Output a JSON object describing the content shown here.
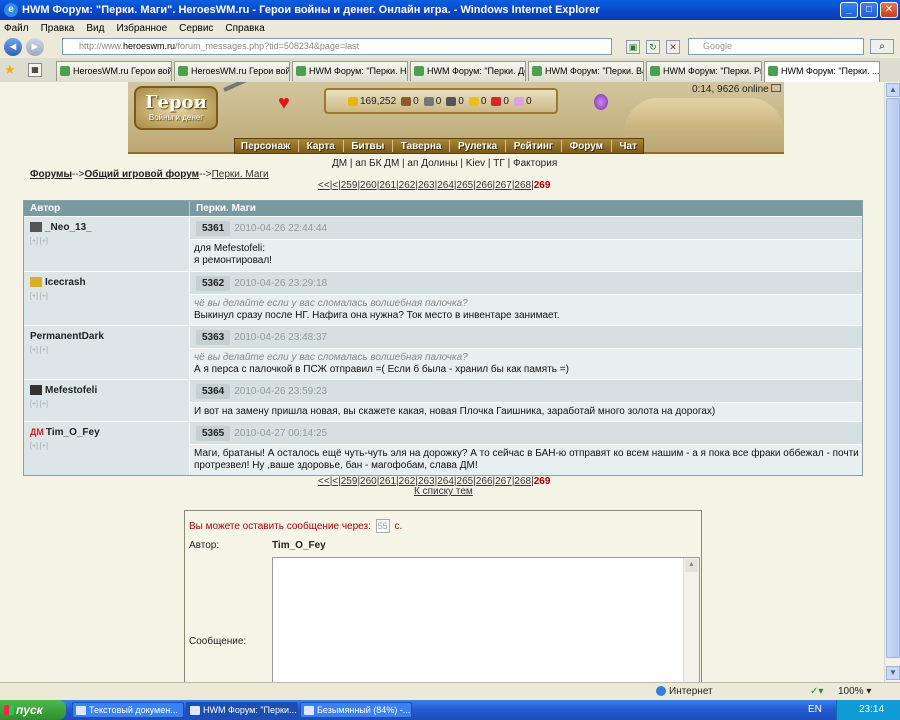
{
  "window": {
    "title": "HWM Форум: \"Перки. Маги\". HeroesWM.ru - Герои войны и денег. Онлайн игра. - Windows Internet Explorer"
  },
  "menu": [
    "Файл",
    "Правка",
    "Вид",
    "Избранное",
    "Сервис",
    "Справка"
  ],
  "address": {
    "prefix": "http://www.",
    "host": "heroeswm.ru",
    "path": "/forum_messages.php?tid=508234&page=last"
  },
  "search": {
    "placeholder": "Google"
  },
  "tabs": [
    "HeroesWM.ru Герои войн...",
    "HeroesWM.ru Герои войн...",
    "HWM Форум: \"Перки. Нек...",
    "HWM Форум: \"Перки. Де...",
    "HWM Форум: \"Перки. Вар...",
    "HWM Форум: \"Перки. Ры...",
    "HWM Форум: \"Перки. ..."
  ],
  "game": {
    "logo_line1": "Герои",
    "logo_line2": "Войны и денег",
    "resources": [
      "169,252",
      "0",
      "0",
      "0",
      "0",
      "0",
      "0"
    ],
    "online": "0:14, 9626 online",
    "nav": [
      "Персонаж",
      "Карта",
      "Битвы",
      "Таверна",
      "Рулетка",
      "Рейтинг",
      "Форум",
      "Чат"
    ],
    "subnav": "ДМ | ап БК ДМ | ап Долины | Kiev | ТГ | Фактория"
  },
  "breadcrumb": {
    "forums": "Форумы",
    "sep1": "-->",
    "general": "Общий игровой форум",
    "sep2": "-->",
    "topic": "Перки. Маги"
  },
  "pager": {
    "first": "<<",
    "prev": "<",
    "pages": [
      "259",
      "260",
      "261",
      "262",
      "263",
      "264",
      "265",
      "266",
      "267",
      "268"
    ],
    "current": "269"
  },
  "table": {
    "col_author": "Автор",
    "col_topic": "Перки. Маги"
  },
  "posts": [
    {
      "author": "_Neo_13_",
      "num": "5361",
      "date": "2010-04-26 22:44:44",
      "quote": "",
      "text": "для Mefestofeli:\nя ремонтировал!",
      "icon_color": "#555555"
    },
    {
      "author": "Icecrash",
      "num": "5362",
      "date": "2010-04-26 23:29:18",
      "quote": "чё вы делайте если у вас сломалась волшебная палочка?",
      "text": "Выкинул сразу после НГ. Нафига она нужна? Ток место в инвентаре занимает.",
      "icon_color": "#d8b020"
    },
    {
      "author": "PermanentDark",
      "num": "5363",
      "date": "2010-04-26 23:48:37",
      "quote": "чё вы делайте если у вас сломалась волшебная палочка?",
      "text": "А я перса с палочкой в ПСЖ отправил =( Если б была - хранил бы как память =)",
      "icon_color": ""
    },
    {
      "author": "Mefestofeli",
      "num": "5364",
      "date": "2010-04-26 23:59:23",
      "quote": "",
      "text": "И вот на замену пришла новая, вы скажете какая, новая Плочка Гаишника, заработай много золота на дорогах)",
      "icon_color": "#333333"
    },
    {
      "author": "Tim_O_Fey",
      "num": "5365",
      "date": "2010-04-27 00:14:25",
      "quote": "",
      "text": "Маги, братаны! А осталось ещё чуть-чуть эля на дорожку? А то сейчас в БАН-ю отправят ко всем нашим - а я пока все фраки оббежал - почти протрезвел! Ну ,ваше здоровье, бан - магофобам, слава ДМ!",
      "icon_color": "#cc2222",
      "tag": "ДМ"
    }
  ],
  "back_link": "К списку тем",
  "reply": {
    "wait_text": "Вы можете оставить сообщение через:",
    "timer": "55",
    "unit": "с.",
    "author_label": "Автор:",
    "author_name": "Tim_O_Fey",
    "message_label": "Сообщение:"
  },
  "status": {
    "zone": "Интернет",
    "zoom": "100%"
  },
  "taskbar": {
    "start": "пуск",
    "tasks": [
      "Текстовый докумен...",
      "HWM Форум: \"Перки...",
      "Безымянный (84%) -..."
    ],
    "lang": "EN",
    "clock": "23:14"
  }
}
